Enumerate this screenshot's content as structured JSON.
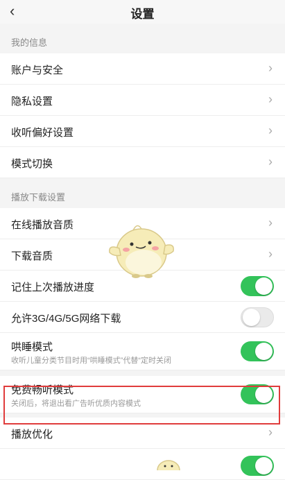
{
  "nav": {
    "title": "设置",
    "back_icon": "chevron-left-icon"
  },
  "sections": {
    "my_info": "我的信息",
    "playback": "播放下载设置"
  },
  "items": {
    "account": "账户与安全",
    "privacy": "隐私设置",
    "listening_pref": "收听偏好设置",
    "mode_switch": "模式切换",
    "online_quality": "在线播放音质",
    "download_quality": "下载音质",
    "remember_progress": "记住上次播放进度",
    "allow_cellular": "允许3G/4G/5G网络下载",
    "sleep_mode": "哄睡模式",
    "sleep_mode_desc": "收听儿童分类节目时用“哄睡模式”代替“定时关闭",
    "free_mode": "免费畅听模式",
    "free_mode_desc": "关闭后，将退出看广告听优质内容模式",
    "playback_opt": "播放优化"
  },
  "toggles": {
    "remember_progress": true,
    "allow_cellular": false,
    "sleep_mode": true,
    "free_mode": true
  },
  "colors": {
    "accent_green": "#33c35a",
    "highlight_red": "#e03b3b"
  }
}
